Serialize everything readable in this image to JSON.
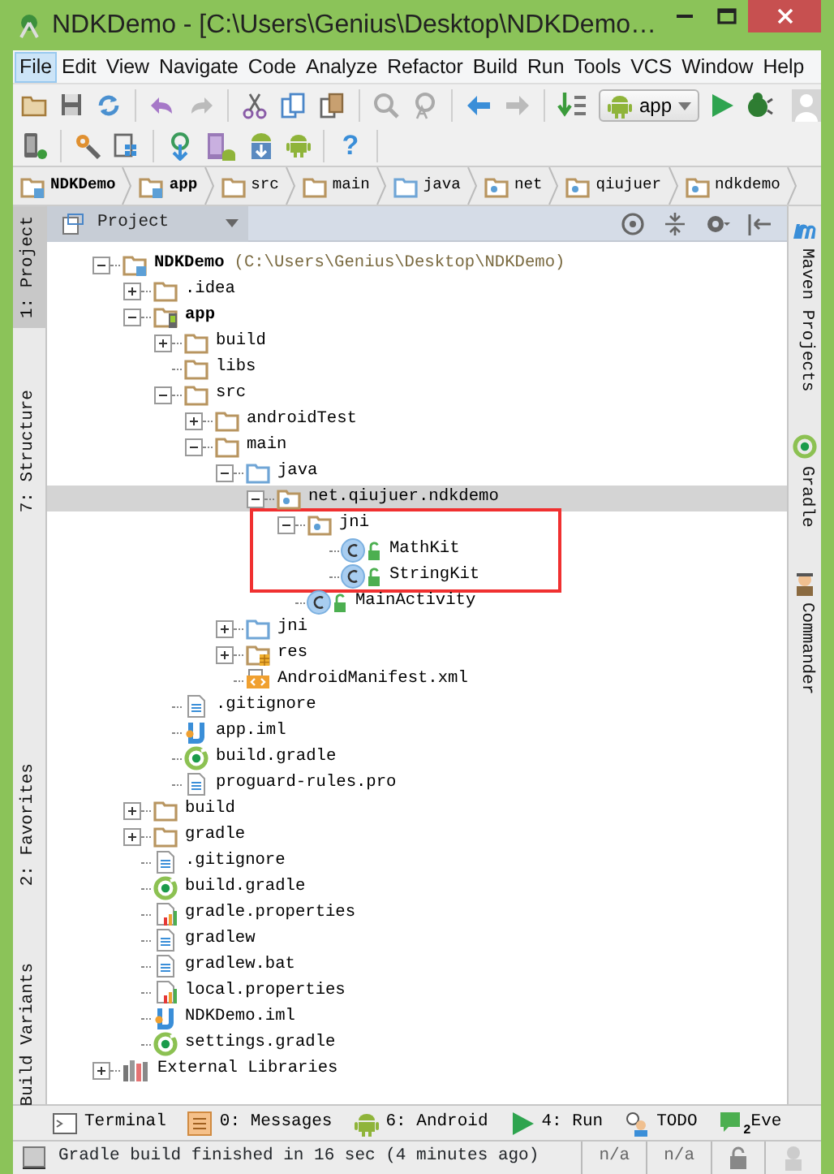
{
  "window": {
    "title": "NDKDemo - [C:\\Users\\Genius\\Desktop\\NDKDemo…"
  },
  "menu": [
    {
      "label": "File",
      "selected": true
    },
    {
      "label": "Edit",
      "selected": false
    },
    {
      "label": "View",
      "selected": false
    },
    {
      "label": "Navigate",
      "selected": false
    },
    {
      "label": "Code",
      "selected": false
    },
    {
      "label": "Analyze",
      "selected": false
    },
    {
      "label": "Refactor",
      "selected": false
    },
    {
      "label": "Build",
      "selected": false
    },
    {
      "label": "Run",
      "selected": false
    },
    {
      "label": "Tools",
      "selected": false
    },
    {
      "label": "VCS",
      "selected": false
    },
    {
      "label": "Window",
      "selected": false
    },
    {
      "label": "Help",
      "selected": false
    }
  ],
  "toolbar": {
    "run_configuration": "app",
    "help": "?"
  },
  "breadcrumbs": [
    {
      "label": "NDKDemo",
      "kind": "module-folder",
      "bold": true
    },
    {
      "label": "app",
      "kind": "module-folder",
      "bold": true
    },
    {
      "label": "src",
      "kind": "folder",
      "bold": false
    },
    {
      "label": "main",
      "kind": "folder",
      "bold": false
    },
    {
      "label": "java",
      "kind": "source-folder",
      "bold": false
    },
    {
      "label": "net",
      "kind": "package",
      "bold": false
    },
    {
      "label": "qiujuer",
      "kind": "package",
      "bold": false
    },
    {
      "label": "ndkdemo",
      "kind": "package",
      "bold": false
    }
  ],
  "left_tool_strip": [
    {
      "label": "1: Project",
      "selected": true
    },
    {
      "label": "7: Structure",
      "selected": false
    },
    {
      "label": "2: Favorites",
      "selected": false
    },
    {
      "label": "Build Variants",
      "selected": false
    }
  ],
  "right_tool_strip": [
    {
      "label": "Maven Projects"
    },
    {
      "label": "Gradle"
    },
    {
      "label": "Commander"
    }
  ],
  "project_panel": {
    "view": "Project",
    "tree": [
      {
        "label": "NDKDemo",
        "suffix": "(C:\\Users\\Genius\\Desktop\\NDKDemo)",
        "kind": "module-folder",
        "bold": true,
        "expanded": true,
        "selected": false,
        "children": [
          {
            "label": ".idea",
            "kind": "folder",
            "bold": false,
            "expanded": false,
            "selected": false
          },
          {
            "label": "app",
            "kind": "android-module",
            "bold": true,
            "expanded": true,
            "selected": false,
            "children": [
              {
                "label": "build",
                "kind": "folder",
                "bold": false,
                "expanded": false,
                "selected": false
              },
              {
                "label": "libs",
                "kind": "folder",
                "bold": false,
                "selected": false
              },
              {
                "label": "src",
                "kind": "folder",
                "bold": false,
                "expanded": true,
                "selected": false,
                "children": [
                  {
                    "label": "androidTest",
                    "kind": "folder",
                    "bold": false,
                    "expanded": false,
                    "selected": false
                  },
                  {
                    "label": "main",
                    "kind": "folder",
                    "bold": false,
                    "expanded": true,
                    "selected": false,
                    "children": [
                      {
                        "label": "java",
                        "kind": "source-folder",
                        "bold": false,
                        "expanded": true,
                        "selected": false,
                        "children": [
                          {
                            "label": "net.qiujuer.ndkdemo",
                            "kind": "package",
                            "bold": false,
                            "expanded": true,
                            "selected": true,
                            "children": [
                              {
                                "label": "jni",
                                "kind": "package",
                                "bold": false,
                                "expanded": true,
                                "selected": false,
                                "highlighted": true,
                                "children": [
                                  {
                                    "label": "MathKit",
                                    "kind": "class",
                                    "bold": false,
                                    "selected": false
                                  },
                                  {
                                    "label": "StringKit",
                                    "kind": "class",
                                    "bold": false,
                                    "selected": false
                                  }
                                ]
                              },
                              {
                                "label": "MainActivity",
                                "kind": "class",
                                "bold": false,
                                "selected": false
                              }
                            ]
                          }
                        ]
                      },
                      {
                        "label": "jni",
                        "kind": "source-folder",
                        "bold": false,
                        "expanded": false,
                        "selected": false
                      },
                      {
                        "label": "res",
                        "kind": "resource-folder",
                        "bold": false,
                        "expanded": false,
                        "selected": false
                      },
                      {
                        "label": "AndroidManifest.xml",
                        "kind": "manifest",
                        "bold": false,
                        "selected": false
                      }
                    ]
                  }
                ]
              },
              {
                "label": ".gitignore",
                "kind": "text-file",
                "bold": false,
                "selected": false
              },
              {
                "label": "app.iml",
                "kind": "iml-file",
                "bold": false,
                "selected": false
              },
              {
                "label": "build.gradle",
                "kind": "gradle-file",
                "bold": false,
                "selected": false
              },
              {
                "label": "proguard-rules.pro",
                "kind": "text-file",
                "bold": false,
                "selected": false
              }
            ]
          },
          {
            "label": "build",
            "kind": "folder",
            "bold": false,
            "expanded": false,
            "selected": false
          },
          {
            "label": "gradle",
            "kind": "folder",
            "bold": false,
            "expanded": false,
            "selected": false
          },
          {
            "label": ".gitignore",
            "kind": "text-file",
            "bold": false,
            "selected": false
          },
          {
            "label": "build.gradle",
            "kind": "gradle-file",
            "bold": false,
            "selected": false
          },
          {
            "label": "gradle.properties",
            "kind": "properties-file",
            "bold": false,
            "selected": false
          },
          {
            "label": "gradlew",
            "kind": "text-file",
            "bold": false,
            "selected": false
          },
          {
            "label": "gradlew.bat",
            "kind": "text-file",
            "bold": false,
            "selected": false
          },
          {
            "label": "local.properties",
            "kind": "properties-file",
            "bold": false,
            "selected": false
          },
          {
            "label": "NDKDemo.iml",
            "kind": "iml-file",
            "bold": false,
            "selected": false
          },
          {
            "label": "settings.gradle",
            "kind": "gradle-file",
            "bold": false,
            "selected": false
          }
        ]
      },
      {
        "label": "External Libraries",
        "kind": "libraries",
        "bold": false,
        "expanded": false,
        "selected": false
      }
    ]
  },
  "tool_windows": [
    {
      "label": "Terminal",
      "kind": "terminal"
    },
    {
      "label": "0: Messages",
      "kind": "messages"
    },
    {
      "label": "6: Android",
      "kind": "android"
    },
    {
      "label": "4: Run",
      "kind": "run"
    },
    {
      "label": "TODO",
      "kind": "todo"
    },
    {
      "label": "Eve",
      "kind": "events",
      "badge": "2"
    }
  ],
  "status_bar": {
    "message": "Gradle build finished in 16 sec (4 minutes ago)",
    "cells": [
      "n/a",
      "n/a"
    ]
  }
}
